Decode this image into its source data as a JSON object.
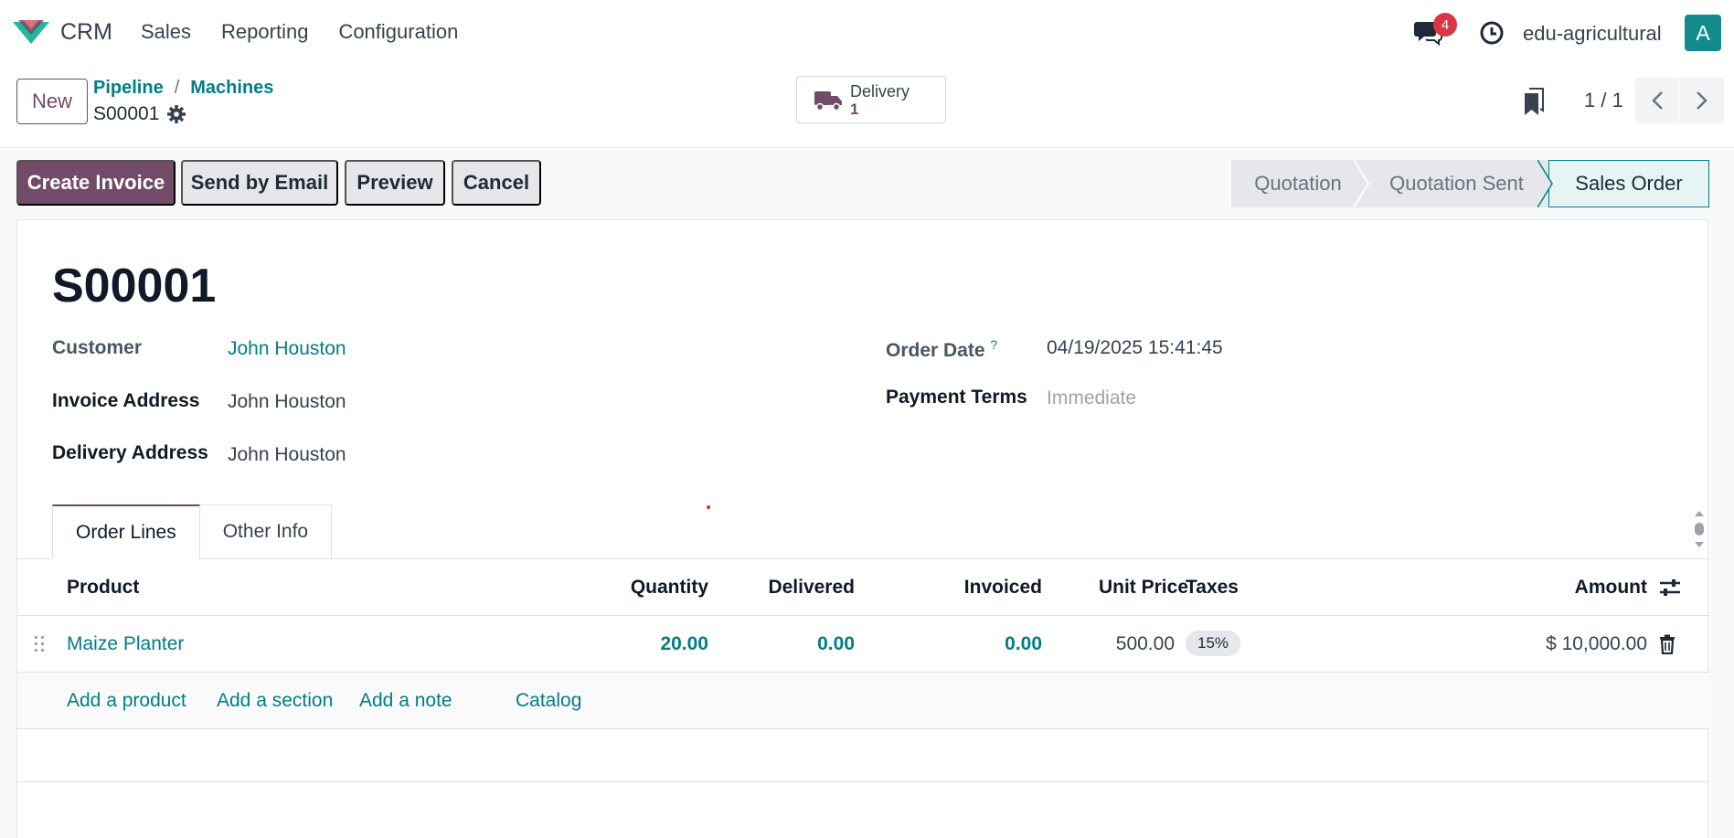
{
  "navbar": {
    "app_name": "CRM",
    "menu": [
      "Sales",
      "Reporting",
      "Configuration"
    ],
    "message_count": "4",
    "company": "edu-agricultural",
    "avatar_letter": "A"
  },
  "control": {
    "new_label": "New",
    "breadcrumb": [
      "Pipeline",
      "Machines"
    ],
    "breadcrumb_sep": "/",
    "record_name": "S00001",
    "smart_button": {
      "label": "Delivery",
      "count": "1"
    },
    "pager": "1 / 1"
  },
  "actions": {
    "create_invoice": "Create Invoice",
    "send_email": "Send by Email",
    "preview": "Preview",
    "cancel": "Cancel"
  },
  "statusbar": {
    "stages": [
      "Quotation",
      "Quotation Sent",
      "Sales Order"
    ],
    "active": "Sales Order"
  },
  "form": {
    "title": "S00001",
    "customer_label": "Customer",
    "customer": "John Houston",
    "invoice_address_label": "Invoice Address",
    "invoice_address": "John Houston",
    "delivery_address_label": "Delivery Address",
    "delivery_address": "John Houston",
    "order_date_label": "Order Date",
    "order_date_help": "?",
    "order_date": "04/19/2025 15:41:45",
    "payment_terms_label": "Payment Terms",
    "payment_terms_placeholder": "Immediate"
  },
  "tabs": [
    "Order Lines",
    "Other Info"
  ],
  "table": {
    "headers": {
      "product": "Product",
      "quantity": "Quantity",
      "delivered": "Delivered",
      "invoiced": "Invoiced",
      "unit_price": "Unit Price",
      "taxes": "Taxes",
      "amount": "Amount"
    },
    "rows": [
      {
        "product": "Maize Planter",
        "quantity": "20.00",
        "delivered": "0.00",
        "invoiced": "0.00",
        "unit_price": "500.00",
        "taxes": "15%",
        "amount": "$ 10,000.00"
      }
    ],
    "add_links": [
      "Add a product",
      "Add a section",
      "Add a note",
      "Catalog"
    ]
  },
  "colors": {
    "brand": "#714b67",
    "link": "#017e84",
    "badge": "#dc3545",
    "avatar": "#138b8c"
  }
}
